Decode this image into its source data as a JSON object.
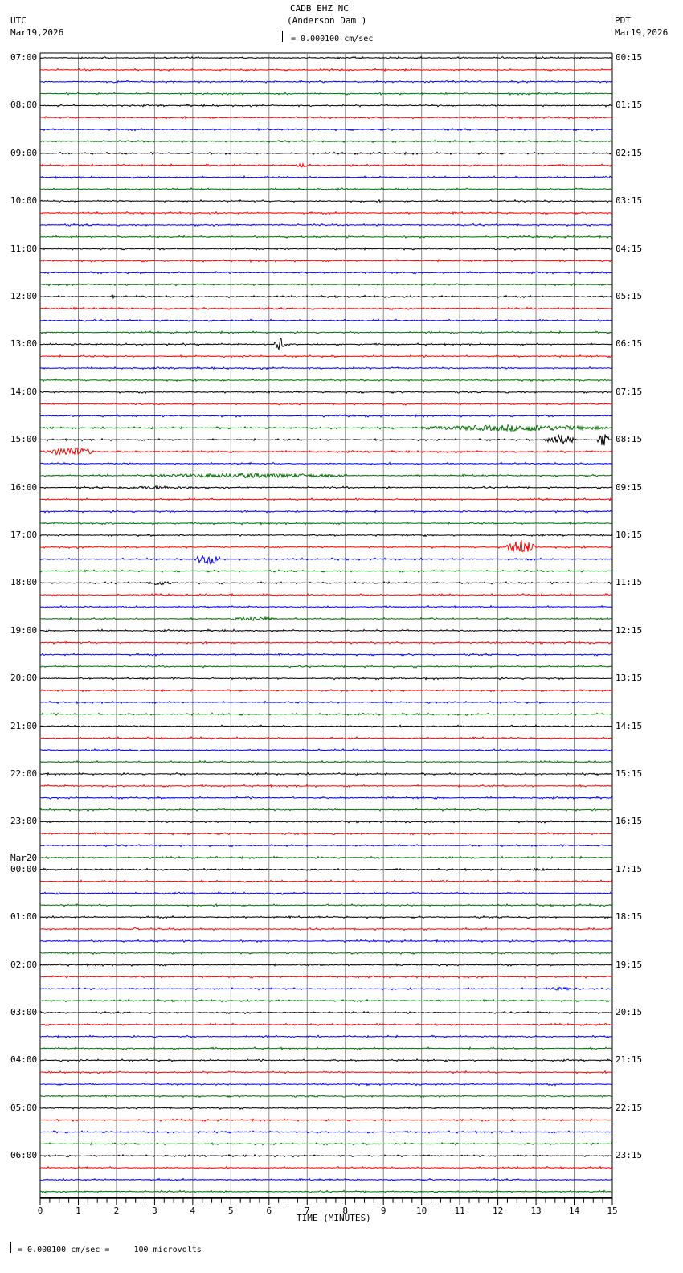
{
  "header": {
    "title": "CADB EHZ NC",
    "subtitle": "(Anderson Dam )",
    "left_tz": "UTC",
    "left_date": "Mar19,2026",
    "right_tz": "PDT",
    "right_date": "Mar19,2026",
    "scale": "= 0.000100 cm/sec"
  },
  "footer": {
    "scale_note": "= 0.000100 cm/sec =     100 microvolts"
  },
  "chart_data": {
    "type": "line",
    "title": "CADB EHZ NC (Anderson Dam )",
    "xlabel": "TIME (MINUTES)",
    "xlim": [
      0,
      15
    ],
    "x_ticks": [
      "0",
      "1",
      "2",
      "3",
      "4",
      "5",
      "6",
      "7",
      "8",
      "9",
      "10",
      "11",
      "12",
      "13",
      "14",
      "15"
    ],
    "traces_per_hour": 4,
    "trace_count": 96,
    "trace_colors": [
      "#000000",
      "#ff0000",
      "#0000ff",
      "#007000"
    ],
    "grid": "vertical every minute",
    "left_labels": [
      "07:00",
      "08:00",
      "09:00",
      "10:00",
      "11:00",
      "12:00",
      "13:00",
      "14:00",
      "15:00",
      "16:00",
      "17:00",
      "18:00",
      "19:00",
      "20:00",
      "21:00",
      "22:00",
      "23:00",
      "00:00",
      "01:00",
      "02:00",
      "03:00",
      "04:00",
      "05:00",
      "06:00"
    ],
    "date_change_label": "Mar20",
    "date_change_hour_index": 17,
    "right_labels": [
      "00:15",
      "01:15",
      "02:15",
      "03:15",
      "04:15",
      "05:15",
      "06:15",
      "07:15",
      "08:15",
      "09:15",
      "10:15",
      "11:15",
      "12:15",
      "13:15",
      "14:15",
      "15:15",
      "16:15",
      "17:15",
      "18:15",
      "19:15",
      "20:15",
      "21:15",
      "22:15",
      "23:15"
    ],
    "events": [
      {
        "trace": 9,
        "start_min": 6.7,
        "end_min": 7.0,
        "amplitude": 3
      },
      {
        "trace": 20,
        "start_min": 1.85,
        "end_min": 2.0,
        "amplitude": 3
      },
      {
        "trace": 20,
        "start_min": 2.6,
        "end_min": 2.7,
        "amplitude": 2
      },
      {
        "trace": 24,
        "start_min": 6.15,
        "end_min": 6.4,
        "amplitude": 9
      },
      {
        "trace": 31,
        "start_min": 10.0,
        "end_min": 14.9,
        "amplitude": 4
      },
      {
        "trace": 32,
        "start_min": 13.2,
        "end_min": 14.0,
        "amplitude": 7
      },
      {
        "trace": 32,
        "start_min": 14.6,
        "end_min": 14.9,
        "amplitude": 9
      },
      {
        "trace": 33,
        "start_min": 0.2,
        "end_min": 1.4,
        "amplitude": 6
      },
      {
        "trace": 35,
        "start_min": 3.0,
        "end_min": 8.0,
        "amplitude": 3
      },
      {
        "trace": 36,
        "start_min": 2.0,
        "end_min": 4.2,
        "amplitude": 2
      },
      {
        "trace": 41,
        "start_min": 12.2,
        "end_min": 13.0,
        "amplitude": 9
      },
      {
        "trace": 42,
        "start_min": 4.1,
        "end_min": 4.7,
        "amplitude": 8
      },
      {
        "trace": 44,
        "start_min": 2.8,
        "end_min": 3.4,
        "amplitude": 3
      },
      {
        "trace": 47,
        "start_min": 5.0,
        "end_min": 6.2,
        "amplitude": 3
      },
      {
        "trace": 68,
        "start_min": 12.8,
        "end_min": 13.3,
        "amplitude": 2
      },
      {
        "trace": 73,
        "start_min": 2.4,
        "end_min": 2.6,
        "amplitude": 3
      },
      {
        "trace": 78,
        "start_min": 13.2,
        "end_min": 14.1,
        "amplitude": 2
      }
    ]
  }
}
